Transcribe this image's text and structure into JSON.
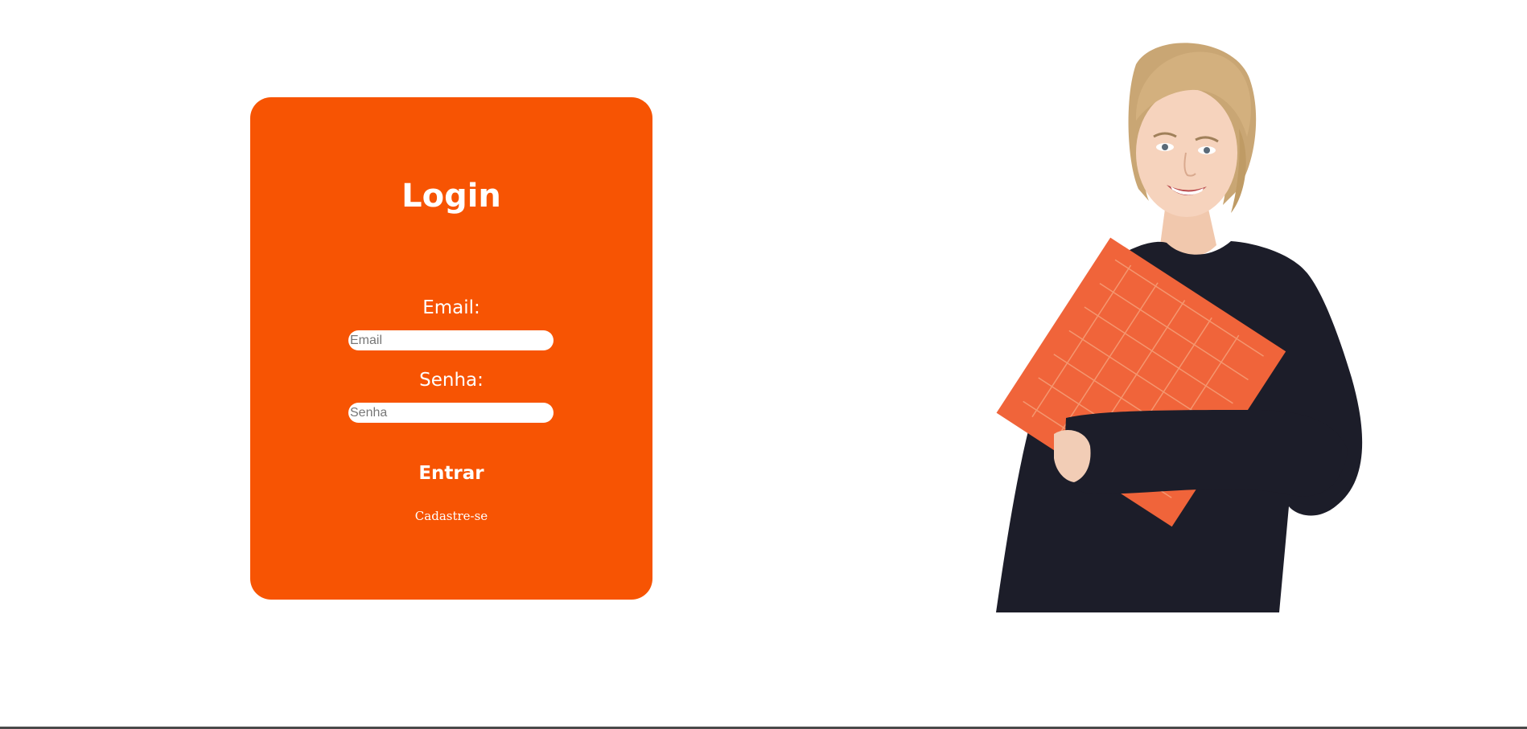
{
  "login": {
    "title": "Login",
    "email_label": "Email:",
    "email_placeholder": "Email",
    "email_value": "",
    "password_label": "Senha:",
    "password_placeholder": "Senha",
    "password_value": "",
    "submit_label": "Entrar",
    "signup_link": "Cadastre-se"
  },
  "hero": {
    "image": "woman-holding-orange-folder"
  },
  "colors": {
    "brand": "#f75403",
    "folder": "#f0643a",
    "sweater": "#1c1d29",
    "background": "#ffffff"
  }
}
